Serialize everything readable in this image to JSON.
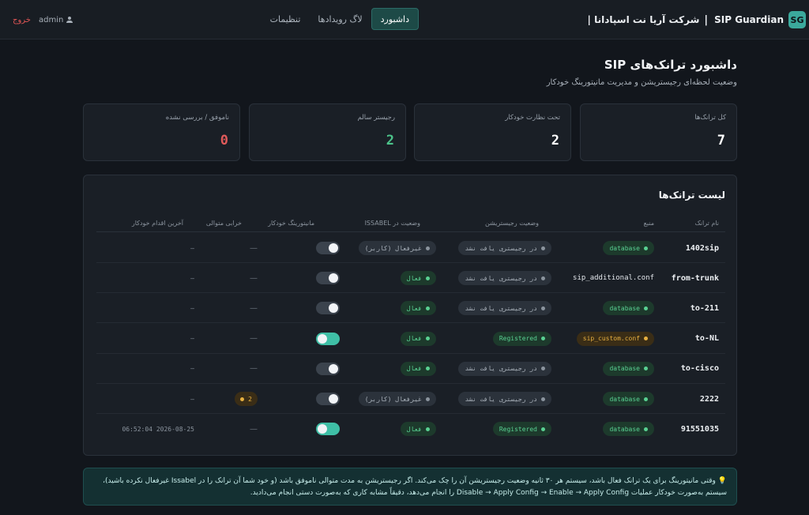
{
  "header": {
    "logo": "SG",
    "app_name": "SIP Guardian",
    "separator": "|",
    "company": "شرکت آریا نت اسپادانا |",
    "nav": [
      {
        "label": "داشبورد",
        "active": true
      },
      {
        "label": "لاگ رویدادها",
        "active": false
      },
      {
        "label": "تنظیمات",
        "active": false
      }
    ],
    "user": "admin",
    "logout": "خروج"
  },
  "page": {
    "title": "داشبورد ترانک‌های SIP",
    "subtitle": "وضعیت لحظه‌ای رجیستریشن و مدیریت مانیتورینگ خودکار"
  },
  "stats": [
    {
      "label": "کل ترانک‌ها",
      "value": "7",
      "color": "#ffffff"
    },
    {
      "label": "تحت نظارت خودکار",
      "value": "2",
      "color": "#ffffff"
    },
    {
      "label": "رجیستر سالم",
      "value": "2",
      "color": "#4cc38a"
    },
    {
      "label": "ناموفق / بررسی نشده",
      "value": "0",
      "color": "#e05a5a"
    }
  ],
  "table": {
    "title": "لیست ترانک‌ها",
    "headers": [
      "نام ترانک",
      "منبع",
      "وضعیت رجیستریشن",
      "وضعیت در ISSABEL",
      "مانیتورینگ خودکار",
      "خرابی متوالی",
      "آخرین اقدام خودکار"
    ],
    "rows": [
      {
        "name": "1402sip",
        "source": "database",
        "source_style": "db",
        "registration": "در رجیستری یافت نشد",
        "reg_style": "gray",
        "issabel": "غیرفعال (کاربر)",
        "iss_style": "gray",
        "monitor": false,
        "failures": "—",
        "last_action": "—"
      },
      {
        "name": "from-trunk",
        "source": "sip_additional.conf",
        "source_style": "plain",
        "registration": "در رجیستری یافت نشد",
        "reg_style": "gray",
        "issabel": "فعال",
        "iss_style": "green",
        "monitor": false,
        "failures": "—",
        "last_action": "—"
      },
      {
        "name": "to-211",
        "source": "database",
        "source_style": "db",
        "registration": "در رجیستری یافت نشد",
        "reg_style": "gray",
        "issabel": "فعال",
        "iss_style": "green",
        "monitor": false,
        "failures": "—",
        "last_action": "—"
      },
      {
        "name": "to-NL",
        "source": "sip_custom.conf",
        "source_style": "custom",
        "registration": "Registered",
        "reg_style": "green",
        "issabel": "فعال",
        "iss_style": "green",
        "monitor": true,
        "failures": "—",
        "last_action": "—"
      },
      {
        "name": "to-cisco",
        "source": "database",
        "source_style": "db",
        "registration": "در رجیستری یافت نشد",
        "reg_style": "gray",
        "issabel": "فعال",
        "iss_style": "green",
        "monitor": false,
        "failures": "—",
        "last_action": "—"
      },
      {
        "name": "2222",
        "source": "database",
        "source_style": "db",
        "registration": "در رجیستری یافت نشد",
        "reg_style": "gray",
        "issabel": "غیرفعال (کاربر)",
        "iss_style": "gray",
        "monitor": false,
        "failures": "2",
        "last_action": "—"
      },
      {
        "name": "91551035",
        "source": "database",
        "source_style": "db",
        "registration": "Registered",
        "reg_style": "green",
        "issabel": "فعال",
        "iss_style": "green",
        "monitor": true,
        "failures": "—",
        "last_action": "2026-08-25 06:52:04"
      }
    ]
  },
  "note": {
    "icon": "💡",
    "line1": "وقتی مانیتورینگ برای یک ترانک فعال باشد، سیستم هر ۳۰ ثانیه وضعیت رجیستریشن آن را چک می‌کند. اگر رجیستریشن به مدت متوالی ناموفق باشد (و خود شما آن ترانک را در Issabel غیرفعال نکرده باشید)،",
    "line2": "سیستم به‌صورت خودکار عملیات Disable → Apply Config → Enable → Apply Config را انجام می‌دهد، دقیقاً مشابه کاری که به‌صورت دستی انجام می‌دادید."
  }
}
